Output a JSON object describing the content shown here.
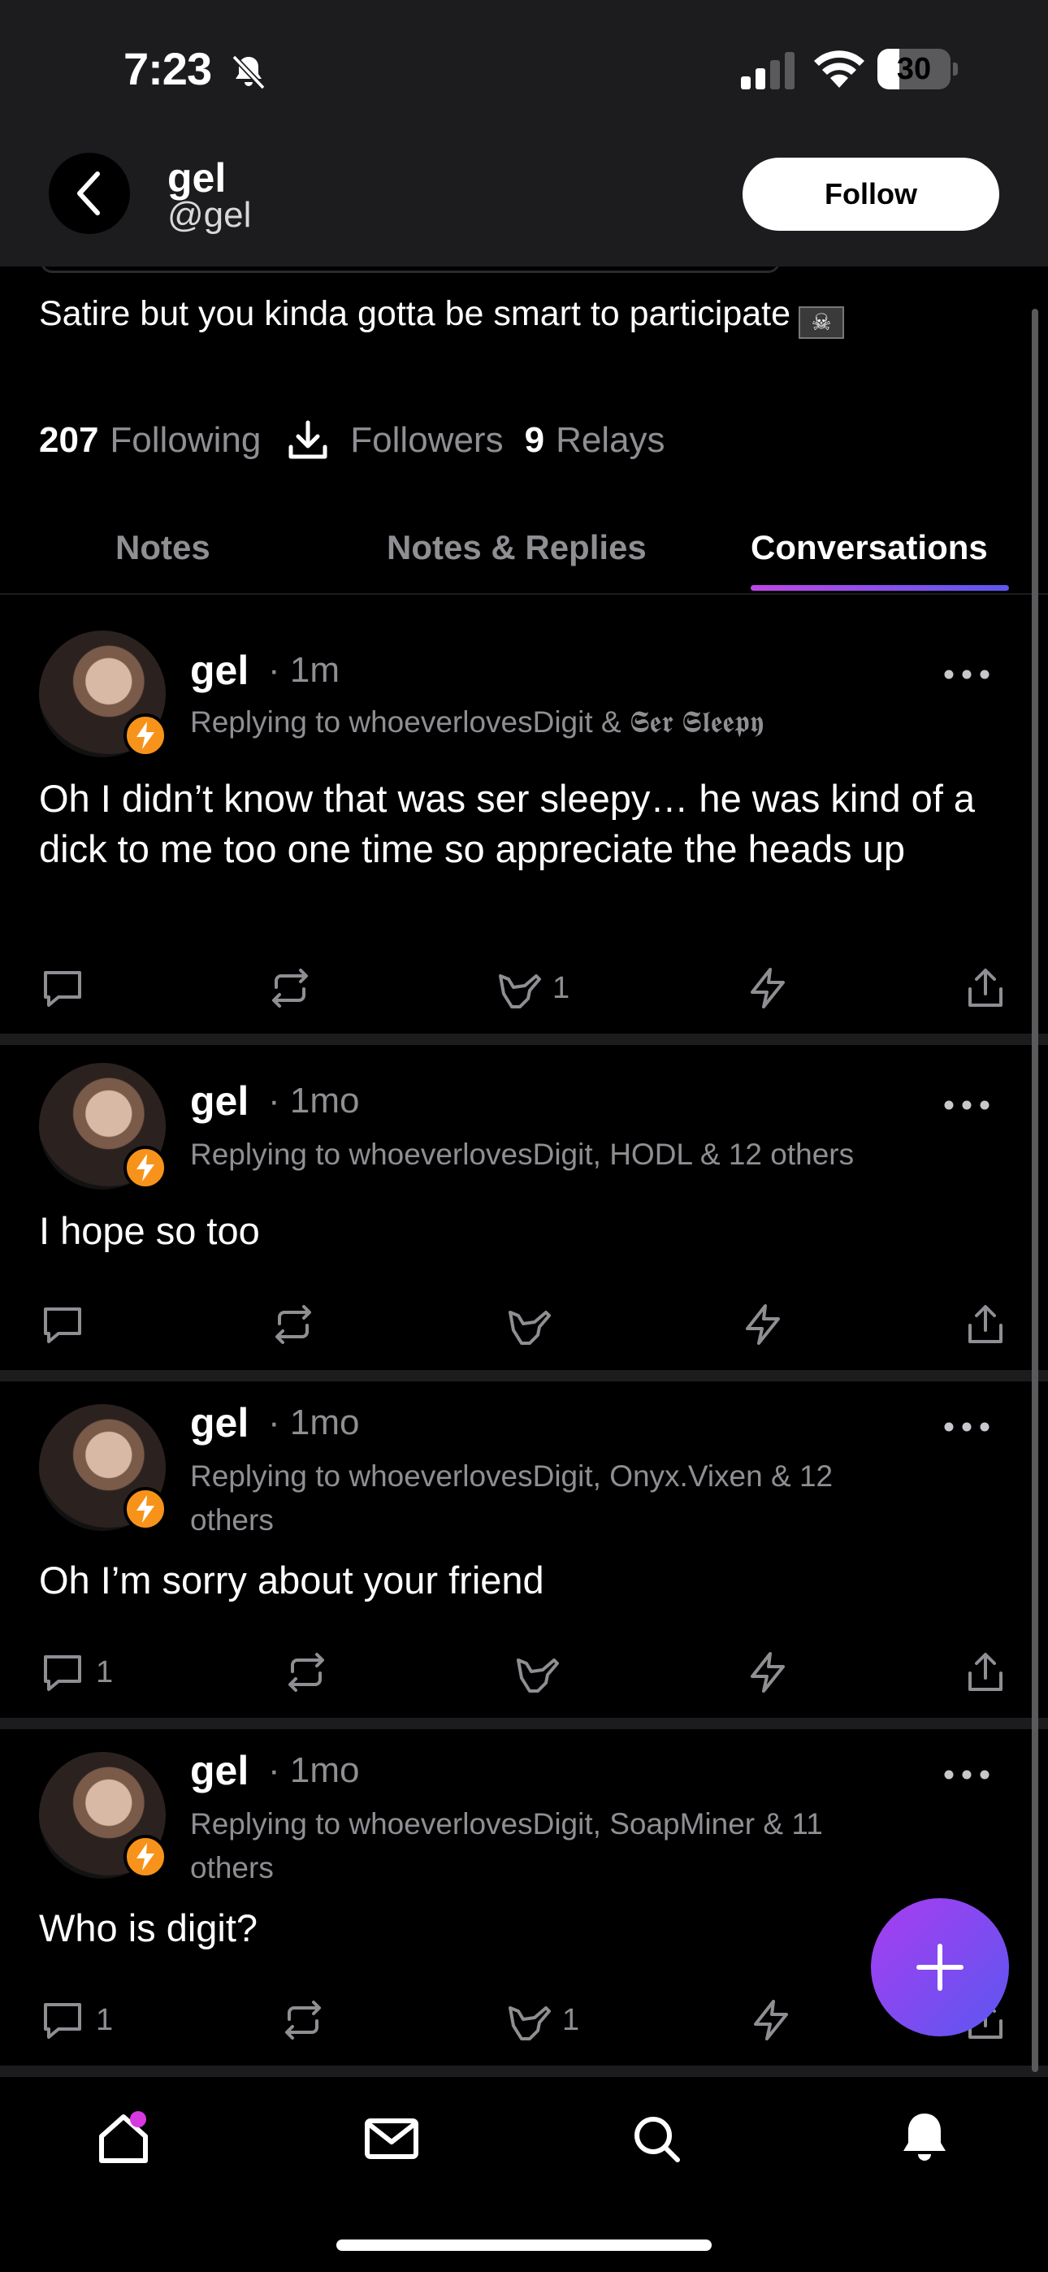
{
  "status_bar": {
    "time": "7:23",
    "battery": "30",
    "battery_level": 0.3
  },
  "header": {
    "name": "gel",
    "handle": "@gel",
    "follow_label": "Follow"
  },
  "profile": {
    "bio": "Satire but you kinda gotta be smart to participate",
    "flag_glyph": "☠",
    "following_count": "207",
    "following_label": "Following",
    "followers_label": "Followers",
    "relays_count": "9",
    "relays_label": "Relays"
  },
  "tabs": [
    {
      "label": "Notes",
      "active": false
    },
    {
      "label": "Notes & Replies",
      "active": false
    },
    {
      "label": "Conversations",
      "active": true
    }
  ],
  "posts": [
    {
      "author": "gel",
      "time": "· 1m",
      "reply_line": "Replying to whoeverlovesDigit & 𝕾𝖊𝖗 𝕾𝖑𝖊𝖊𝖕𝖞",
      "body": "Oh I didn’t know that was ser sleepy… he was kind of a dick to me too one time so appreciate the heads up",
      "reply_count": "",
      "like_count": "1"
    },
    {
      "author": "gel",
      "time": "· 1mo",
      "reply_line": "Replying to whoeverlovesDigit, HODL & 12 others",
      "body": "I hope so too",
      "reply_count": "",
      "like_count": ""
    },
    {
      "author": "gel",
      "time": "· 1mo",
      "reply_line": "Replying to whoeverlovesDigit, Onyx.Vixen & 12 others",
      "body": "Oh I’m sorry about your friend",
      "reply_count": "1",
      "like_count": ""
    },
    {
      "author": "gel",
      "time": "· 1mo",
      "reply_line": "Replying to whoeverlovesDigit, SoapMiner & 11 others",
      "body": "Who is digit?",
      "reply_count": "1",
      "like_count": "1"
    }
  ],
  "icons": {
    "nav": [
      "home-icon",
      "mail-icon",
      "search-icon",
      "bell-icon"
    ],
    "actions": [
      "reply-icon",
      "repost-icon",
      "shaka-icon",
      "zap-icon",
      "share-icon"
    ]
  },
  "colors": {
    "accent_gradient_start": "#c046e8",
    "accent_gradient_end": "#5b57f0",
    "zap_badge": "#f7931a",
    "notification_dot": "#d63adf",
    "muted_text": "#8e8e93"
  }
}
